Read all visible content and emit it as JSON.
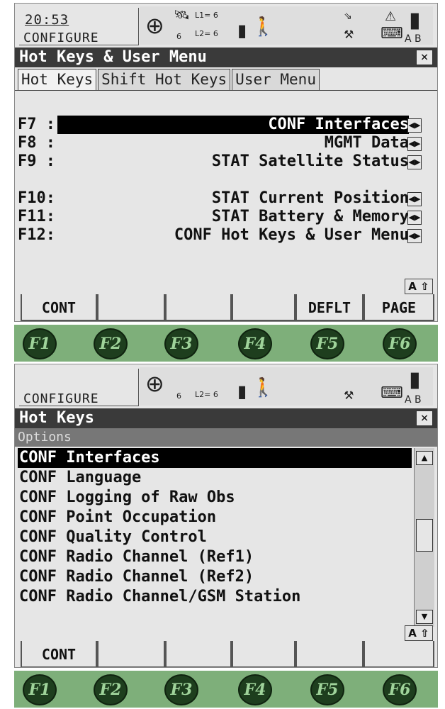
{
  "screen1": {
    "status": {
      "time": "20:53",
      "mode": "CONFIGURE",
      "l1": "L1= 6",
      "l2": "L2= 6",
      "sat_count": "6",
      "mem_labels": "A B"
    },
    "title": "Hot Keys & User Menu",
    "close_label": "×",
    "tabs": [
      "Hot Keys",
      "Shift Hot Keys",
      "User Menu"
    ],
    "hotkeys": [
      {
        "key": "F7 :",
        "value": "CONF Interfaces",
        "selected": true
      },
      {
        "key": "F8 :",
        "value": "MGMT Data"
      },
      {
        "key": "F9 :",
        "value": "STAT Satellite Status"
      },
      {
        "key": "F10:",
        "value": "STAT Current Position"
      },
      {
        "key": "F11:",
        "value": "STAT Battery & Memory"
      },
      {
        "key": "F12:",
        "value": "CONF Hot Keys & User Menu"
      }
    ],
    "input_mode": "A ⇧",
    "softkeys": [
      "CONT",
      "",
      "",
      "",
      "DEFLT",
      "PAGE"
    ]
  },
  "screen2": {
    "status": {
      "mode": "CONFIGURE",
      "l2": "L2= 6",
      "sat_count": "6",
      "mem_labels": "A B"
    },
    "title": "Hot Keys",
    "close_label": "×",
    "list_header": "Options",
    "items": [
      "CONF Interfaces",
      "CONF Language",
      "CONF Logging of Raw Obs",
      "CONF Point Occupation",
      "CONF Quality Control",
      "CONF Radio Channel (Ref1)",
      "CONF Radio Channel (Ref2)",
      "CONF Radio Channel/GSM Station"
    ],
    "input_mode": "A ⇧",
    "softkeys": [
      "CONT",
      "",
      "",
      "",
      "",
      ""
    ]
  },
  "fkeys": [
    "F1",
    "F2",
    "F3",
    "F4",
    "F5",
    "F6"
  ],
  "colors": {
    "fkey_bar": "#7eaf7a",
    "fkey_button": "#1e3e1e",
    "title_bar": "#3a3a3a"
  }
}
